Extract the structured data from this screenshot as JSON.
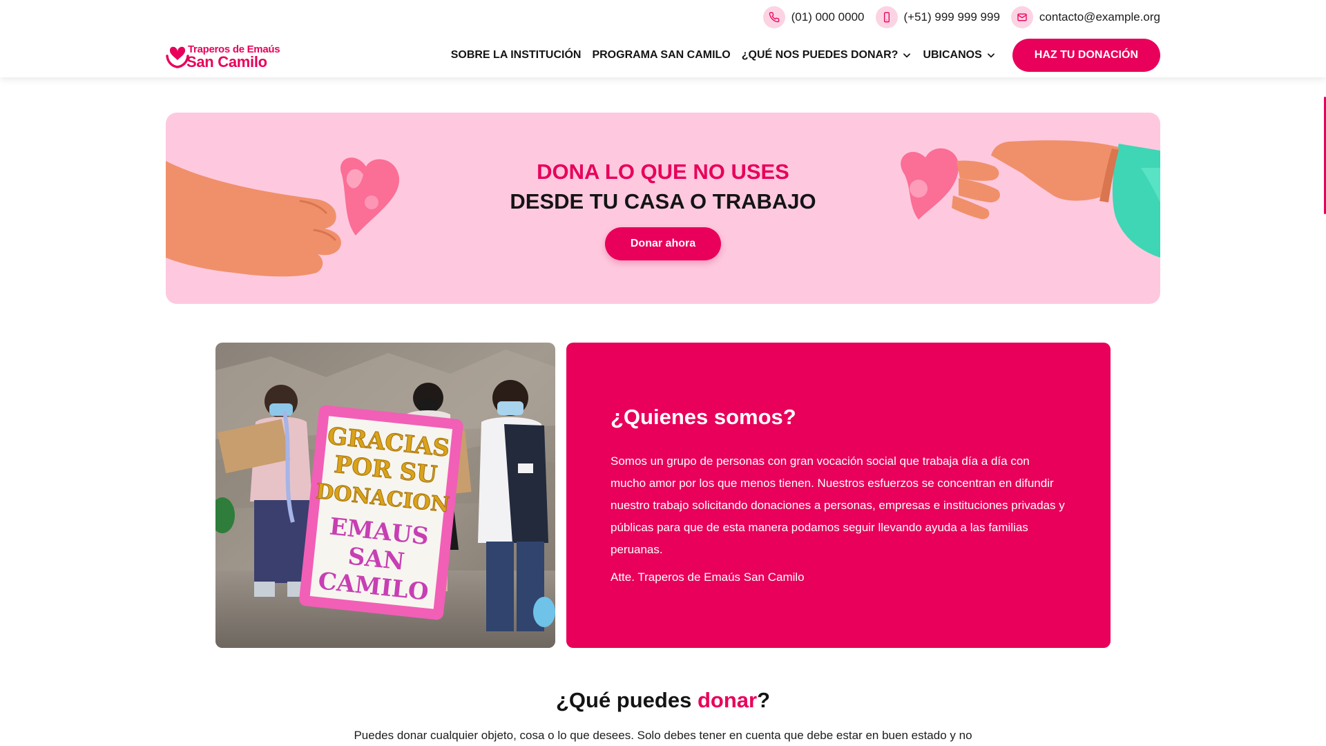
{
  "header": {
    "contacts": {
      "phone": "(01) 000 0000",
      "mobile": "(+51) 999 999 999",
      "email": "contacto@example.org"
    },
    "logo": {
      "line1": "Traperos de Emaús",
      "line2": "San Camilo"
    },
    "nav": {
      "item1": "SOBRE LA INSTITUCIÓN",
      "item2": "PROGRAMA SAN CAMILO",
      "item3": "¿QUÉ NOS PUEDES DONAR?",
      "item4": "UBICANOS",
      "cta": "HAZ TU DONACIÓN"
    }
  },
  "banner": {
    "title_accent": "DONA LO QUE NO USES",
    "title_dark": "DESDE TU CASA O TRABAJO",
    "button": "Donar ahora"
  },
  "about": {
    "title": "¿Quienes somos?",
    "body": "Somos un grupo de personas con gran vocación social que trabaja día a día con mucho amor por los que menos tienen. Nuestros esfuerzos se concentran en difundir nuestro trabajo solicitando donaciones a personas, empresas e instituciones privadas y públicas para que de esta manera podamos seguir llevando ayuda a las familias peruanas.",
    "signature": "Atte. Traperos de Emaús San Camilo",
    "photo_sign": {
      "line1": "GRACIAS",
      "line2": "POR SU",
      "line3": "DONACION",
      "line4": "EMAUS",
      "line5": "SAN",
      "line6": "CAMILO"
    }
  },
  "donate": {
    "title_pre": "¿Qué puedes ",
    "title_accent": "donar",
    "title_post": "?",
    "text": "Puedes donar cualquier objeto, cosa o lo que desees. Solo debes tener en cuenta que debe estar en buen estado y no"
  },
  "colors": {
    "brand": "#e8005a",
    "banner_bg": "#fec9df",
    "icon_bg": "#fcd3e3"
  }
}
